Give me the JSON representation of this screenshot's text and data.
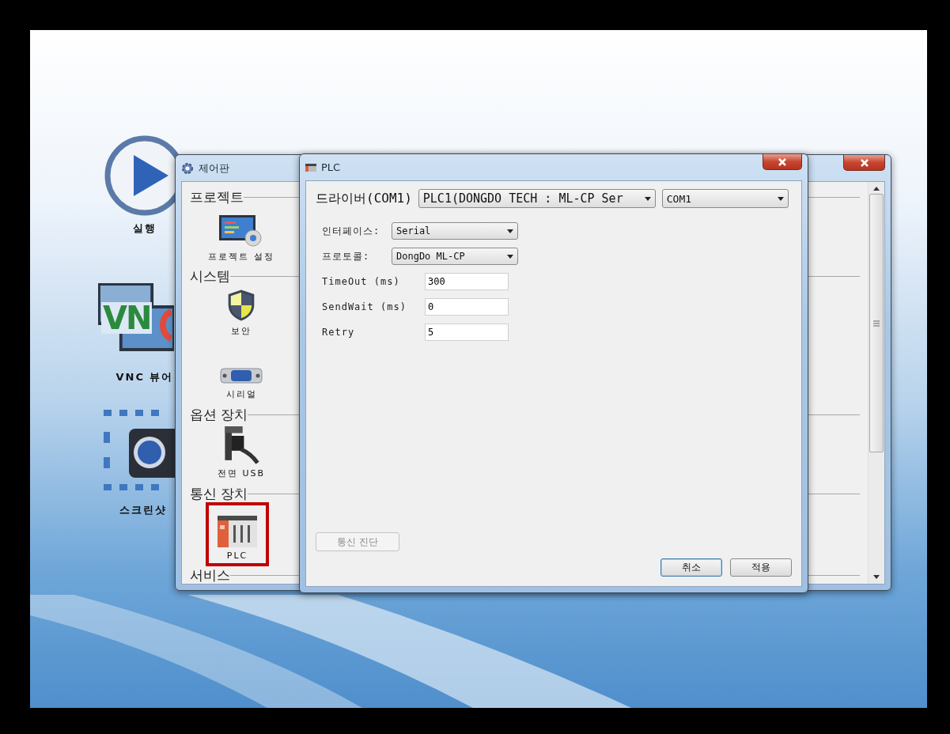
{
  "desktop": {
    "icons": [
      {
        "kind": "play",
        "label": "실행"
      },
      {
        "kind": "vnc",
        "label": "VNC 뷰어",
        "logo_text": "VN"
      },
      {
        "kind": "camera",
        "label": "스크린샷"
      }
    ]
  },
  "control_panel": {
    "title": "제어판",
    "sections": [
      {
        "heading": "프로젝트",
        "items": [
          {
            "kind": "monitor",
            "label": "프로젝트 설정",
            "selected": false
          }
        ]
      },
      {
        "heading": "시스템",
        "items": [
          {
            "kind": "shield",
            "label": "보안",
            "selected": false
          },
          {
            "kind": "serial",
            "label": "시리얼",
            "selected": false
          }
        ]
      },
      {
        "heading": "옵션 장치",
        "items": [
          {
            "kind": "usb",
            "label": "전면 USB",
            "selected": false
          }
        ]
      },
      {
        "heading": "통신 장치",
        "items": [
          {
            "kind": "plc",
            "label": "PLC",
            "selected": true
          }
        ]
      },
      {
        "heading": "서비스"
      }
    ]
  },
  "plc_dialog": {
    "title": "PLC",
    "driver_label": "드라이버(COM1)",
    "driver_value": "PLC1(DONGDO TECH : ML-CP Ser",
    "port_value": "COM1",
    "fields": [
      {
        "kind": "select",
        "label": "인터페이스:",
        "value": "Serial"
      },
      {
        "kind": "select",
        "label": "프로토콜:",
        "value": "DongDo ML-CP"
      },
      {
        "kind": "input",
        "label": "TimeOut (ms)",
        "value": "300"
      },
      {
        "kind": "input",
        "label": "SendWait (ms)",
        "value": "0"
      },
      {
        "kind": "input",
        "label": "Retry",
        "value": "5"
      }
    ],
    "diagnose_button": {
      "label": "통신 진단",
      "disabled": true
    },
    "buttons": [
      {
        "label": "취소",
        "focused": true
      },
      {
        "label": "적용",
        "focused": false
      }
    ]
  }
}
